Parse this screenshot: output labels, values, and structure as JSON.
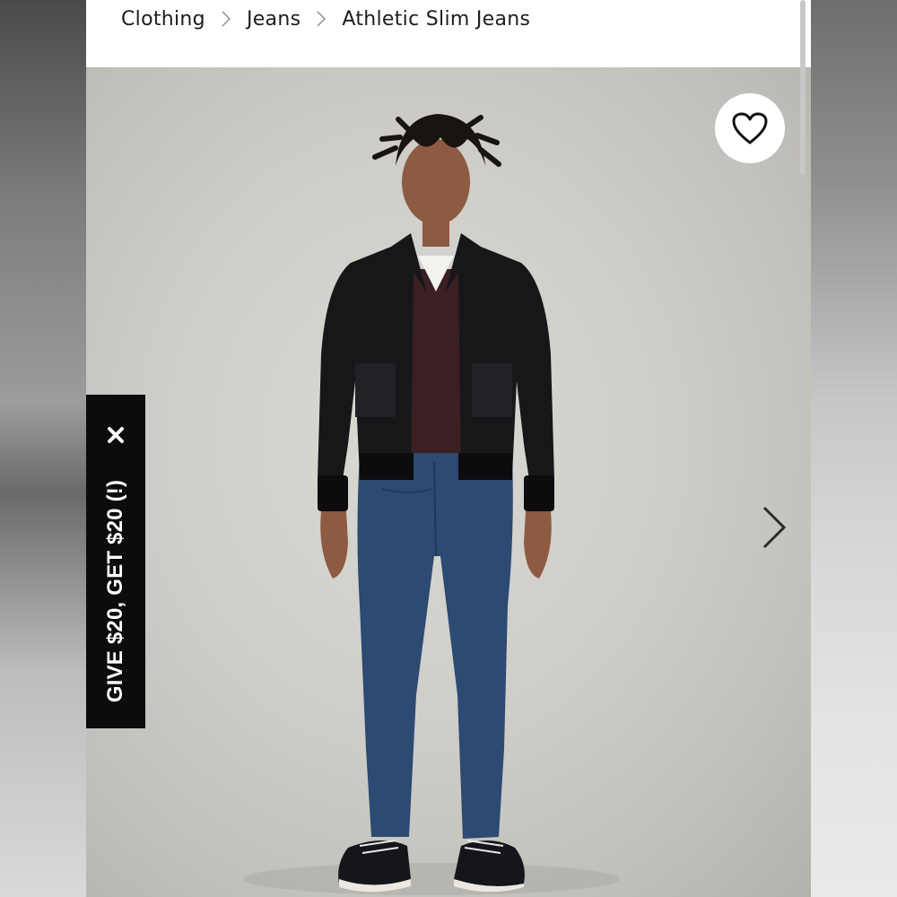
{
  "breadcrumb": {
    "items": [
      {
        "label": "Clothing"
      },
      {
        "label": "Jeans"
      },
      {
        "label": "Athletic Slim Jeans"
      }
    ],
    "separator_icon": "chevron-right-icon"
  },
  "product_image": {
    "favorite_icon": "heart-outline-icon",
    "next_icon": "chevron-right-icon"
  },
  "promo": {
    "text": "GIVE $20, GET $20 (!)",
    "close_icon": "close-icon",
    "background": "#0c0c0c",
    "text_color": "#ffffff"
  }
}
